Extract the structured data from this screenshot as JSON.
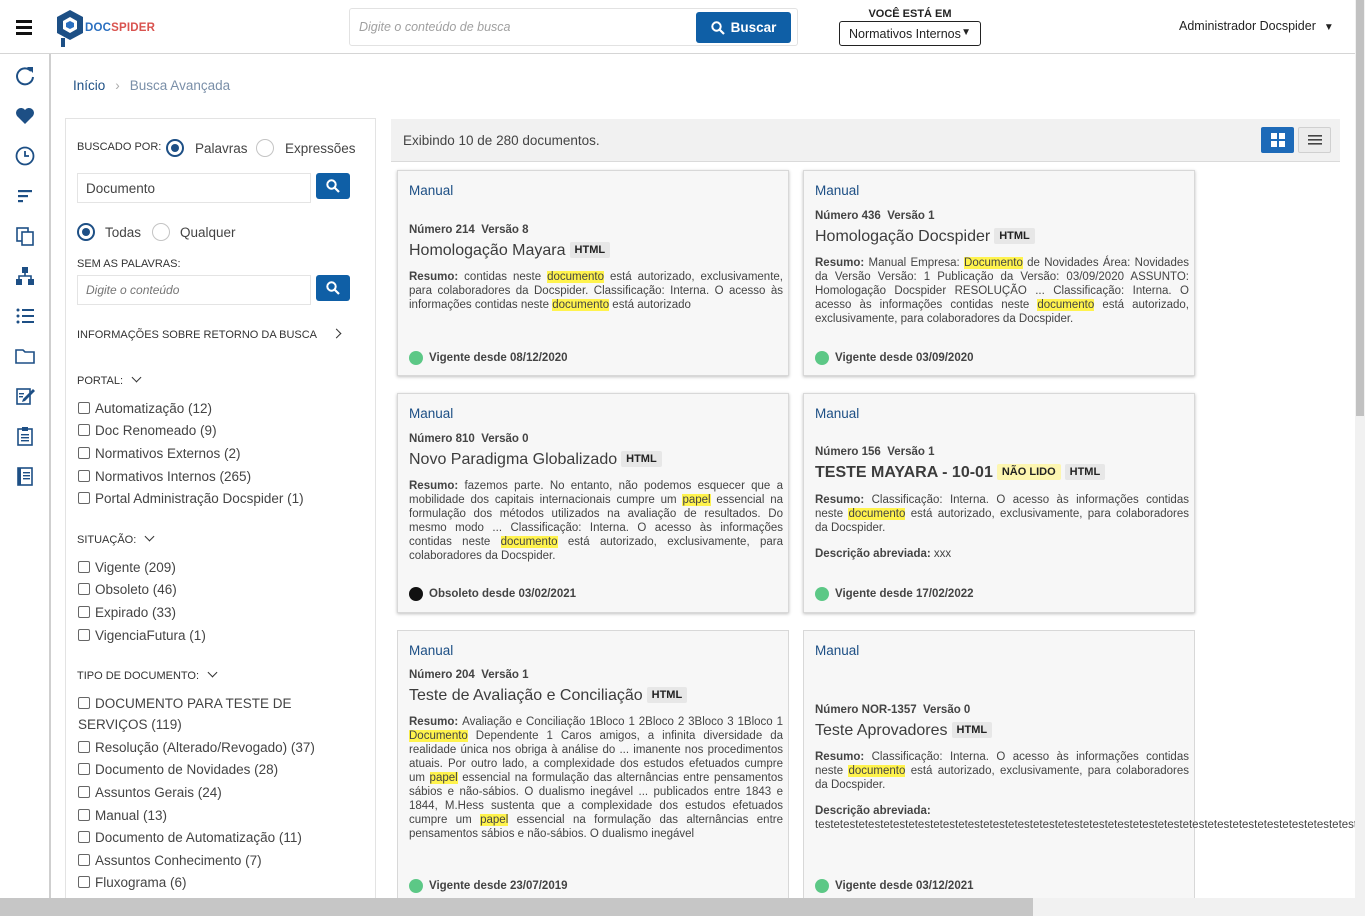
{
  "header": {
    "logo_text_a": "DOC",
    "logo_text_b": "SPIDER",
    "search_placeholder": "Digite o conteúdo de busca",
    "search_button": "Buscar",
    "context_label": "VOCÊ ESTÁ EM",
    "context_value": "Normativos Internos",
    "user_name": "Administrador Docspider"
  },
  "rail_icons": [
    "refresh-icon",
    "heart-icon",
    "clock-icon",
    "sort-icon",
    "copy-icon",
    "hierarchy-icon",
    "list-icon",
    "folder-icon",
    "edit-icon",
    "clipboard-icon",
    "book-icon"
  ],
  "breadcrumb": {
    "home": "Início",
    "current": "Busca Avançada"
  },
  "filters": {
    "searched_by_label": "BUSCADO POR:",
    "opt_words": "Palavras",
    "opt_expressions": "Expressões",
    "search_value": "Documento",
    "opt_all": "Todas",
    "opt_any": "Qualquer",
    "without_label": "SEM AS PALAVRAS:",
    "without_placeholder": "Digite o conteúdo",
    "info_title": "INFORMAÇÕES SOBRE RETORNO DA BUSCA",
    "portal_title": "PORTAL:",
    "portal_items": [
      "Automatização (12)",
      "Doc Renomeado (9)",
      "Normativos Externos (2)",
      "Normativos Internos (265)",
      "Portal Administração Docspider (1)"
    ],
    "situacao_title": "SITUAÇÃO:",
    "situacao_items": [
      "Vigente (209)",
      "Obsoleto (46)",
      "Expirado (33)",
      "VigenciaFutura (1)"
    ],
    "tipo_title": "TIPO DE DOCUMENTO:",
    "tipo_items": [
      "DOCUMENTO PARA TESTE DE SERVIÇOS (119)",
      "Resolução (Alterado/Revogado) (37)",
      "Documento de Novidades (28)",
      "Assuntos Gerais (24)",
      "Manual (13)",
      "Documento de Automatização (11)",
      "Assuntos Conhecimento (7)",
      "Fluxograma (6)"
    ]
  },
  "results": {
    "count_text": "Exibindo 10 de 280 documentos.",
    "cards": [
      {
        "type": "Manual",
        "number": "Número 214",
        "version": "Versão 8",
        "title": "Homologação Mayara",
        "tag": "HTML",
        "status": "Vigente desde 08/12/2020"
      },
      {
        "type": "Manual",
        "number": "Número 436",
        "version": "Versão 1",
        "title": "Homologação Docspider",
        "tag": "HTML",
        "status": "Vigente desde 03/09/2020"
      },
      {
        "type": "Manual",
        "number": "Número 810",
        "version": "Versão 0",
        "title": "Novo Paradigma Globalizado",
        "tag": "HTML",
        "status": "Obsoleto desde 03/02/2021"
      },
      {
        "type": "Manual",
        "number": "Número 156",
        "version": "Versão 1",
        "title": "TESTE MAYARA - 10-01",
        "tag_unread": "NÃO LIDO",
        "tag": "HTML",
        "desc_label": "Descrição abreviada:",
        "desc_value": "xxx",
        "status": "Vigente desde 17/02/2022"
      },
      {
        "type": "Manual",
        "number": "Número 204",
        "version": "Versão 1",
        "title": "Teste de Avaliação e Conciliação",
        "tag": "HTML",
        "status": "Vigente desde 23/07/2019"
      },
      {
        "type": "Manual",
        "number": "Número NOR-1357",
        "version": "Versão 0",
        "title": "Teste Aprovadores",
        "tag": "HTML",
        "desc_label": "Descrição abreviada:",
        "desc_value": "testetestetestetestetestetestetestetestetestetestetestetestetestetestetestetestetestetestetestetestetestetestete",
        "status": "Vigente desde 03/12/2021"
      }
    ],
    "resumo_label": "Resumo:",
    "highlight_words": [
      "documento",
      "Documento",
      "papel"
    ],
    "snippets": [
      [
        "contidas neste ",
        "documento",
        " está autorizado, exclusivamente, para colaboradores da Docspider. Classificação: Interna. O acesso às informações contidas neste ",
        "documento",
        " está autorizado"
      ],
      [
        "    Manual Empresa: ",
        "Documento",
        " de Novidades Área: Novidades da Versão Versão: 1 Publicação da Versão: 03/09/2020 ASSUNTO: Homologação Docspider RESOLUÇÃO ... Classificação: Interna. O acesso às informações contidas neste ",
        "documento",
        " está autorizado, exclusivamente, para colaboradores da Docspider."
      ],
      [
        "fazemos parte. No entanto, não podemos esquecer que a mobilidade dos capitais internacionais cumpre um ",
        "papel",
        " essencial na formulação dos métodos utilizados na avaliação de resultados.            Do mesmo modo ... Classificação: Interna. O acesso às informações contidas neste ",
        "documento",
        " está autorizado, exclusivamente, para colaboradores da Docspider."
      ],
      [
        "Classificação: Interna. O acesso às informações contidas neste ",
        "documento",
        " está autorizado, exclusivamente, para colaboradores da Docspider."
      ],
      [
        "Avaliação e Conciliação 1Bloco 1 2Bloco 2 3Bloco 3 1Bloco 1 ",
        "Documento",
        " Dependente 1  Caros amigos, a infinita diversidade da realidade única nos obriga à análise do ... imanente nos procedimentos atuais. Por outro lado, a complexidade dos estudos efetuados cumpre um ",
        "papel",
        " essencial na formulação das alternâncias entre pensamentos sábios e não-sábios. O dualismo inegável ... publicados entre 1843 e 1844, M.Hess sustenta que a complexidade dos estudos efetuados cumpre um ",
        "papel",
        " essencial na formulação das alternâncias entre pensamentos sábios e não-sábios. O dualismo inegável"
      ],
      [
        "Classificação: Interna. O acesso às informações contidas neste ",
        "documento",
        " está autorizado, exclusivamente, para colaboradores da Docspider."
      ]
    ]
  },
  "colors": {
    "primary": "#0f5fa6",
    "link": "#1d4f85",
    "vigente": "#5cc886",
    "obsoleto": "#111111",
    "highlight": "#fff34d"
  }
}
